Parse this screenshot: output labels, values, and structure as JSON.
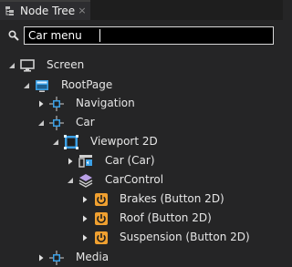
{
  "tab": {
    "title": "Node Tree",
    "close": "×"
  },
  "search": {
    "value": "Car menu",
    "placeholder": ""
  },
  "tree": [
    {
      "label": "Screen",
      "icon": "monitor-icon",
      "expand": "expanded"
    },
    {
      "label": "RootPage",
      "icon": "page-icon",
      "expand": "expanded"
    },
    {
      "label": "Navigation",
      "icon": "node-icon",
      "expand": "collapsed"
    },
    {
      "label": "Car",
      "icon": "node-icon",
      "expand": "expanded"
    },
    {
      "label": "Viewport 2D",
      "icon": "viewport-icon",
      "expand": "expanded"
    },
    {
      "label": "Car (Car)",
      "icon": "camera-node-icon",
      "expand": "collapsed"
    },
    {
      "label": "CarControl",
      "icon": "layers-icon",
      "expand": "expanded"
    },
    {
      "label": "Brakes (Button 2D)",
      "icon": "power-button-icon",
      "expand": "collapsed"
    },
    {
      "label": "Roof (Button 2D)",
      "icon": "power-button-icon",
      "expand": "collapsed"
    },
    {
      "label": "Suspension (Button 2D)",
      "icon": "power-button-icon",
      "expand": "collapsed"
    },
    {
      "label": "Media",
      "icon": "node-icon",
      "expand": "collapsed"
    }
  ],
  "colors": {
    "accent": "#f0a030",
    "node_blue": "#3ba0e6",
    "background": "#252526"
  }
}
